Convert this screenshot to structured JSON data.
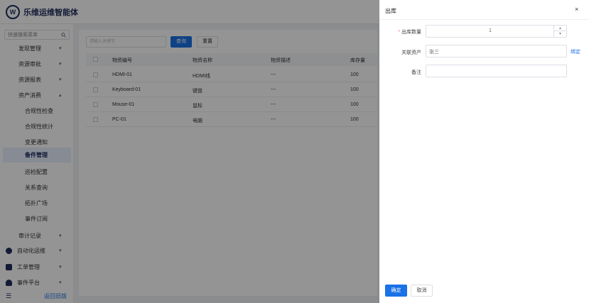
{
  "app": {
    "brand": "乐维运维智能体",
    "logo_text": "W"
  },
  "sidebar": {
    "search_placeholder": "快速搜索菜单",
    "items": [
      {
        "label": "发现管理"
      },
      {
        "label": "资源审批"
      },
      {
        "label": "资源报表"
      },
      {
        "label": "资产消费"
      },
      {
        "label": "合规性检查"
      },
      {
        "label": "合规性统计"
      },
      {
        "label": "变更通知"
      },
      {
        "label": "备件管理"
      },
      {
        "label": "巡检配置"
      },
      {
        "label": "关系查询"
      },
      {
        "label": "拓扑广场"
      },
      {
        "label": "事件订阅"
      },
      {
        "label": "审计记录"
      },
      {
        "label": "自动化运维"
      },
      {
        "label": "工单管理"
      },
      {
        "label": "事件平台"
      }
    ],
    "footer": "返回旧版"
  },
  "main": {
    "search_placeholder": "请输入关键字",
    "query_label": "查询",
    "reset_label": "重置",
    "columns": [
      "物资编号",
      "物资名称",
      "物资描述",
      "库存量"
    ],
    "rows": [
      {
        "code": "HDMI-01",
        "name": "HDMI线",
        "desc": "---",
        "qty": "100"
      },
      {
        "code": "Keyboard-01",
        "name": "键盘",
        "desc": "---",
        "qty": "100"
      },
      {
        "code": "Mouse-01",
        "name": "鼠标",
        "desc": "---",
        "qty": "100"
      },
      {
        "code": "PC-01",
        "name": "电脑",
        "desc": "---",
        "qty": "100"
      }
    ]
  },
  "drawer": {
    "title": "出库",
    "close": "×",
    "qty_label": "出库数量",
    "qty_value": "1",
    "asset_label": "关联资产",
    "asset_value": "张三",
    "bind_link": "绑定",
    "note_label": "备注",
    "note_value": "",
    "ok_label": "确定",
    "cancel_label": "取消"
  }
}
